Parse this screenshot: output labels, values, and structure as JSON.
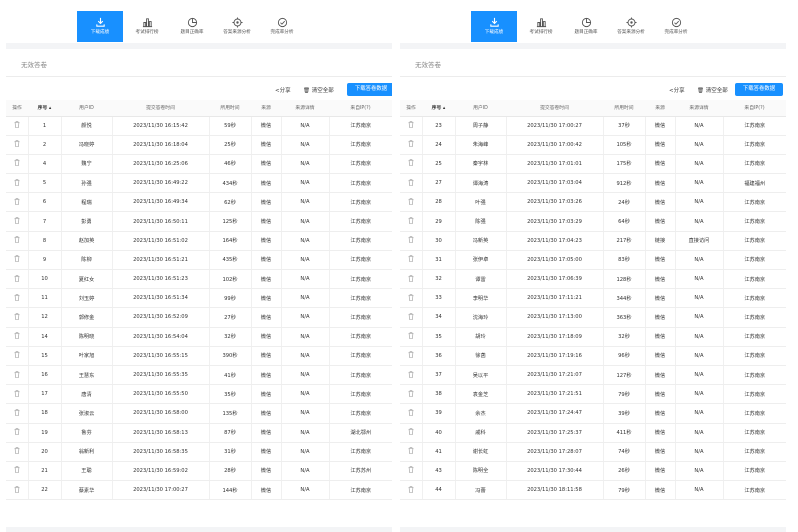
{
  "tabs": [
    {
      "label": "下载成绩",
      "icon": "download-icon",
      "active": true
    },
    {
      "label": "考试排行榜",
      "icon": "bar-chart-icon",
      "active": false
    },
    {
      "label": "题目正确率",
      "icon": "pie-chart-icon",
      "active": false
    },
    {
      "label": "答案来源分析",
      "icon": "target-icon",
      "active": false
    },
    {
      "label": "完成率分析",
      "icon": "check-circle-icon",
      "active": false
    }
  ],
  "invalid_label": "无效答卷",
  "share_label": "分享",
  "clear_label": "清空全部",
  "download_label": "下载答卷数据",
  "headers": {
    "action": "操作",
    "seq": "序号",
    "user": "用户ID",
    "time": "提交答卷时间",
    "duration": "所用时间",
    "source": "来源",
    "detail": "来源详情",
    "ip": "来自IP(?)"
  },
  "colors": {
    "accent": "#1890ff"
  },
  "left_rows": [
    [
      "1",
      "颜悦",
      "2023/11/30 16:15:42",
      "59秒",
      "微信",
      "N/A",
      "江苏南京"
    ],
    [
      "2",
      "冯晓婷",
      "2023/11/30 16:18:04",
      "25秒",
      "微信",
      "N/A",
      "江苏南京"
    ],
    [
      "4",
      "魏宁",
      "2023/11/30 16:25:06",
      "46秒",
      "微信",
      "N/A",
      "江苏南京"
    ],
    [
      "5",
      "孙强",
      "2023/11/30 16:49:22",
      "434秒",
      "微信",
      "N/A",
      "江苏南京"
    ],
    [
      "6",
      "程瑞",
      "2023/11/30 16:49:34",
      "62秒",
      "微信",
      "N/A",
      "江苏南京"
    ],
    [
      "7",
      "彭勇",
      "2023/11/30 16:50:11",
      "125秒",
      "微信",
      "N/A",
      "江苏南京"
    ],
    [
      "8",
      "赵加英",
      "2023/11/30 16:51:02",
      "164秒",
      "微信",
      "N/A",
      "江苏南京"
    ],
    [
      "9",
      "陈柳",
      "2023/11/30 16:51:21",
      "435秒",
      "微信",
      "N/A",
      "江苏南京"
    ],
    [
      "10",
      "夏红女",
      "2023/11/30 16:51:23",
      "102秒",
      "微信",
      "N/A",
      "江苏南京"
    ],
    [
      "11",
      "刘玉婷",
      "2023/11/30 16:51:34",
      "99秒",
      "微信",
      "N/A",
      "江苏南京"
    ],
    [
      "12",
      "郭修金",
      "2023/11/30 16:52:09",
      "27秒",
      "微信",
      "N/A",
      "江苏南京"
    ],
    [
      "14",
      "陈明晓",
      "2023/11/30 16:54:04",
      "32秒",
      "微信",
      "N/A",
      "江苏南京"
    ],
    [
      "15",
      "叶家旭",
      "2023/11/30 16:55:15",
      "390秒",
      "微信",
      "N/A",
      "江苏南京"
    ],
    [
      "16",
      "王慧东",
      "2023/11/30 16:55:35",
      "41秒",
      "微信",
      "N/A",
      "江苏南京"
    ],
    [
      "17",
      "唐清",
      "2023/11/30 16:55:50",
      "35秒",
      "微信",
      "N/A",
      "江苏南京"
    ],
    [
      "18",
      "张淑云",
      "2023/11/30 16:58:00",
      "135秒",
      "微信",
      "N/A",
      "江苏南京"
    ],
    [
      "19",
      "鲁芬",
      "2023/11/30 16:58:13",
      "87秒",
      "微信",
      "N/A",
      "湖北鄂州"
    ],
    [
      "20",
      "翁新利",
      "2023/11/30 16:58:35",
      "31秒",
      "微信",
      "N/A",
      "江苏南京"
    ],
    [
      "21",
      "王聪",
      "2023/11/30 16:59:02",
      "28秒",
      "微信",
      "N/A",
      "江苏苏州"
    ],
    [
      "22",
      "蔡素华",
      "2023/11/30 17:00:27",
      "144秒",
      "微信",
      "N/A",
      "江苏南京"
    ]
  ],
  "right_rows": [
    [
      "23",
      "周子静",
      "2023/11/30 17:00:27",
      "37秒",
      "微信",
      "N/A",
      "江苏南京"
    ],
    [
      "24",
      "朱海峰",
      "2023/11/30 17:00:42",
      "105秒",
      "微信",
      "N/A",
      "江苏南京"
    ],
    [
      "25",
      "秦宇林",
      "2023/11/30 17:01:01",
      "175秒",
      "微信",
      "N/A",
      "江苏南京"
    ],
    [
      "27",
      "谭海涛",
      "2023/11/30 17:03:04",
      "912秒",
      "微信",
      "N/A",
      "福建福州"
    ],
    [
      "28",
      "叶强",
      "2023/11/30 17:03:26",
      "24秒",
      "微信",
      "N/A",
      "江苏南京"
    ],
    [
      "29",
      "陈强",
      "2023/11/30 17:03:29",
      "64秒",
      "微信",
      "N/A",
      "江苏南京"
    ],
    [
      "30",
      "冯新英",
      "2023/11/30 17:04:23",
      "217秒",
      "链接",
      "直接访问",
      "江苏南京"
    ],
    [
      "31",
      "张伊卓",
      "2023/11/30 17:05:00",
      "83秒",
      "微信",
      "N/A",
      "江苏南京"
    ],
    [
      "32",
      "谭雷",
      "2023/11/30 17:06:39",
      "128秒",
      "微信",
      "N/A",
      "江苏南京"
    ],
    [
      "33",
      "李明华",
      "2023/11/30 17:11:21",
      "344秒",
      "微信",
      "N/A",
      "江苏南京"
    ],
    [
      "34",
      "沈海玲",
      "2023/11/30 17:13:00",
      "363秒",
      "微信",
      "N/A",
      "江苏南京"
    ],
    [
      "35",
      "胡玲",
      "2023/11/30 17:18:09",
      "32秒",
      "微信",
      "N/A",
      "江苏南京"
    ],
    [
      "36",
      "徐菡",
      "2023/11/30 17:19:16",
      "96秒",
      "微信",
      "N/A",
      "江苏南京"
    ],
    [
      "37",
      "吴以平",
      "2023/11/30 17:21:07",
      "127秒",
      "微信",
      "N/A",
      "江苏南京"
    ],
    [
      "38",
      "袁金芝",
      "2023/11/30 17:21:51",
      "79秒",
      "微信",
      "N/A",
      "江苏南京"
    ],
    [
      "39",
      "余杰",
      "2023/11/30 17:24:47",
      "39秒",
      "微信",
      "N/A",
      "江苏南京"
    ],
    [
      "40",
      "戚科",
      "2023/11/30 17:25:37",
      "411秒",
      "微信",
      "N/A",
      "江苏南京"
    ],
    [
      "41",
      "谢长虹",
      "2023/11/30 17:28:07",
      "74秒",
      "微信",
      "N/A",
      "江苏南京"
    ],
    [
      "43",
      "陈明全",
      "2023/11/30 17:30:44",
      "26秒",
      "微信",
      "N/A",
      "江苏南京"
    ],
    [
      "44",
      "冯蕾",
      "2023/11/30 18:11:58",
      "79秒",
      "微信",
      "N/A",
      "江苏南京"
    ]
  ]
}
